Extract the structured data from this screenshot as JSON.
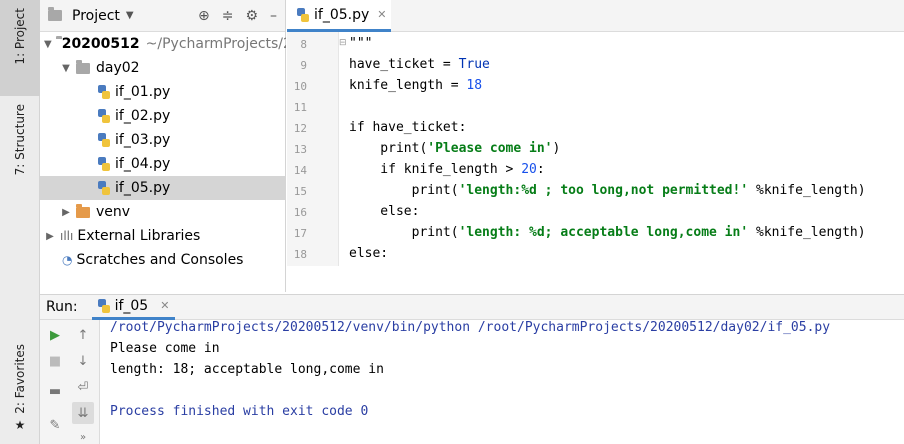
{
  "side_tabs": {
    "project": "1: Project",
    "structure": "7: Structure",
    "favorites": "2: Favorites"
  },
  "project_panel": {
    "title": "Project",
    "tree": [
      {
        "label": "20200512",
        "path": "~/PycharmProjects/2",
        "type": "folder-root"
      },
      {
        "label": "day02",
        "type": "folder"
      },
      {
        "label": "if_01.py",
        "type": "py"
      },
      {
        "label": "if_02.py",
        "type": "py"
      },
      {
        "label": "if_03.py",
        "type": "py"
      },
      {
        "label": "if_04.py",
        "type": "py"
      },
      {
        "label": "if_05.py",
        "type": "py",
        "selected": true
      },
      {
        "label": "venv",
        "type": "folder-orange"
      },
      {
        "label": "External Libraries",
        "type": "libs"
      },
      {
        "label": "Scratches and Consoles",
        "type": "scratch"
      }
    ]
  },
  "editor": {
    "tab_label": "if_05.py",
    "line_numbers": [
      "8",
      "9",
      "10",
      "11",
      "12",
      "13",
      "14",
      "15",
      "16",
      "17",
      "18"
    ],
    "lines": {
      "l8": "\"\"\"",
      "l9a": "have_ticket = ",
      "l9b": "True",
      "l10a": "knife_length = ",
      "l10b": "18",
      "l11": "",
      "l12": "if have_ticket:",
      "l13a": "    print(",
      "l13b": "'Please come in'",
      "l13c": ")",
      "l14a": "    if knife_length > ",
      "l14b": "20",
      "l14c": ":",
      "l15a": "        print(",
      "l15b": "'length:%d ; too long,not permitted!'",
      "l15c": " %knife_length)",
      "l16": "    else:",
      "l17a": "        print(",
      "l17b": "'length: %d; acceptable long,come in'",
      "l17c": " %knife_length)",
      "l18": "else:"
    }
  },
  "run_panel": {
    "label": "Run:",
    "tab_label": "if_05",
    "console": [
      "/root/PycharmProjects/20200512/venv/bin/python /root/PycharmProjects/20200512/day02/if_05.py",
      "Please come in",
      "length: 18; acceptable long,come in",
      "",
      "Process finished with exit code 0"
    ]
  },
  "colors": {
    "accent": "#4083c9",
    "run_green": "#3c9a3c",
    "string_green": "#067d17",
    "number_blue": "#1750eb",
    "console_blue": "#2a3ea3"
  }
}
